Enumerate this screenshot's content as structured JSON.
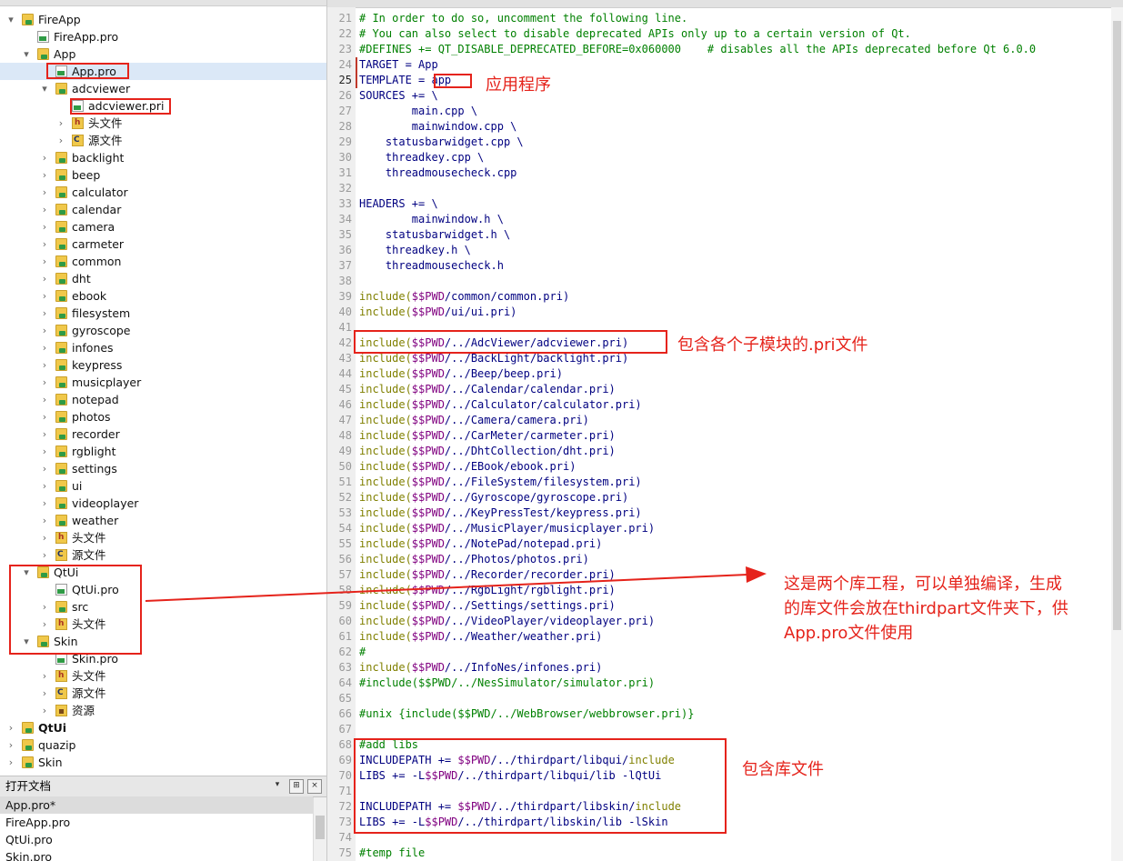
{
  "tree": [
    {
      "label": "FireApp",
      "icon": "folder",
      "arrow": "▾",
      "indent": 0
    },
    {
      "label": "FireApp.pro",
      "icon": "filepro",
      "arrow": "",
      "indent": 1
    },
    {
      "label": "App",
      "icon": "folder",
      "arrow": "▾",
      "indent": 1
    },
    {
      "label": "App.pro",
      "icon": "filepro",
      "arrow": "",
      "indent": 2,
      "selected": true
    },
    {
      "label": "adcviewer",
      "icon": "folder",
      "arrow": "▾",
      "indent": 2
    },
    {
      "label": "adcviewer.pri",
      "icon": "filepro",
      "arrow": "",
      "indent": 3
    },
    {
      "label": "头文件",
      "icon": "hdr",
      "arrow": "›",
      "indent": 3
    },
    {
      "label": "源文件",
      "icon": "src",
      "arrow": "›",
      "indent": 3
    },
    {
      "label": "backlight",
      "icon": "folder",
      "arrow": "›",
      "indent": 2
    },
    {
      "label": "beep",
      "icon": "folder",
      "arrow": "›",
      "indent": 2
    },
    {
      "label": "calculator",
      "icon": "folder",
      "arrow": "›",
      "indent": 2
    },
    {
      "label": "calendar",
      "icon": "folder",
      "arrow": "›",
      "indent": 2
    },
    {
      "label": "camera",
      "icon": "folder",
      "arrow": "›",
      "indent": 2
    },
    {
      "label": "carmeter",
      "icon": "folder",
      "arrow": "›",
      "indent": 2
    },
    {
      "label": "common",
      "icon": "folder",
      "arrow": "›",
      "indent": 2
    },
    {
      "label": "dht",
      "icon": "folder",
      "arrow": "›",
      "indent": 2
    },
    {
      "label": "ebook",
      "icon": "folder",
      "arrow": "›",
      "indent": 2
    },
    {
      "label": "filesystem",
      "icon": "folder",
      "arrow": "›",
      "indent": 2
    },
    {
      "label": "gyroscope",
      "icon": "folder",
      "arrow": "›",
      "indent": 2
    },
    {
      "label": "infones",
      "icon": "folder",
      "arrow": "›",
      "indent": 2
    },
    {
      "label": "keypress",
      "icon": "folder",
      "arrow": "›",
      "indent": 2
    },
    {
      "label": "musicplayer",
      "icon": "folder",
      "arrow": "›",
      "indent": 2
    },
    {
      "label": "notepad",
      "icon": "folder",
      "arrow": "›",
      "indent": 2
    },
    {
      "label": "photos",
      "icon": "folder",
      "arrow": "›",
      "indent": 2
    },
    {
      "label": "recorder",
      "icon": "folder",
      "arrow": "›",
      "indent": 2
    },
    {
      "label": "rgblight",
      "icon": "folder",
      "arrow": "›",
      "indent": 2
    },
    {
      "label": "settings",
      "icon": "folder",
      "arrow": "›",
      "indent": 2
    },
    {
      "label": "ui",
      "icon": "folder",
      "arrow": "›",
      "indent": 2
    },
    {
      "label": "videoplayer",
      "icon": "folder",
      "arrow": "›",
      "indent": 2
    },
    {
      "label": "weather",
      "icon": "folder",
      "arrow": "›",
      "indent": 2
    },
    {
      "label": "头文件",
      "icon": "hdr",
      "arrow": "›",
      "indent": 2
    },
    {
      "label": "源文件",
      "icon": "src",
      "arrow": "›",
      "indent": 2
    },
    {
      "label": "QtUi",
      "icon": "folder",
      "arrow": "▾",
      "indent": 1
    },
    {
      "label": "QtUi.pro",
      "icon": "filepro",
      "arrow": "",
      "indent": 2
    },
    {
      "label": "src",
      "icon": "folder",
      "arrow": "›",
      "indent": 2
    },
    {
      "label": "头文件",
      "icon": "hdr",
      "arrow": "›",
      "indent": 2
    },
    {
      "label": "Skin",
      "icon": "folder",
      "arrow": "▾",
      "indent": 1
    },
    {
      "label": "Skin.pro",
      "icon": "filepro",
      "arrow": "",
      "indent": 2
    },
    {
      "label": "头文件",
      "icon": "hdr",
      "arrow": "›",
      "indent": 2
    },
    {
      "label": "源文件",
      "icon": "src",
      "arrow": "›",
      "indent": 2
    },
    {
      "label": "资源",
      "icon": "res",
      "arrow": "›",
      "indent": 2
    },
    {
      "label": "QtUi",
      "icon": "folder",
      "arrow": "›",
      "indent": 0,
      "bold": true
    },
    {
      "label": "quazip",
      "icon": "folder",
      "arrow": "›",
      "indent": 0
    },
    {
      "label": "Skin",
      "icon": "folder",
      "arrow": "›",
      "indent": 0
    }
  ],
  "open_docs": {
    "title": "打开文档",
    "items": [
      "App.pro*",
      "FireApp.pro",
      "QtUi.pro",
      "Skin.pro"
    ]
  },
  "editor": {
    "current_line": 25,
    "lines": [
      {
        "n": 21,
        "p": [
          [
            "# In order to do so, uncomment the following line.",
            "c"
          ]
        ]
      },
      {
        "n": 22,
        "p": [
          [
            "# You can also select to disable deprecated APIs only up to a certain version of Qt.",
            "c"
          ]
        ]
      },
      {
        "n": 23,
        "p": [
          [
            "#DEFINES += QT_DISABLE_DEPRECATED_BEFORE=0x060000    # disables all the APIs deprecated before Qt 6.0.0",
            "c"
          ]
        ]
      },
      {
        "n": 24,
        "p": [
          [
            "TARGET = App",
            "p"
          ]
        ]
      },
      {
        "n": 25,
        "p": [
          [
            "TEMPLATE = app",
            "p"
          ]
        ]
      },
      {
        "n": 26,
        "p": [
          [
            "SOURCES += \\",
            "p"
          ]
        ]
      },
      {
        "n": 27,
        "p": [
          [
            "        main.cpp \\",
            "p"
          ]
        ]
      },
      {
        "n": 28,
        "p": [
          [
            "        mainwindow.cpp \\",
            "p"
          ]
        ]
      },
      {
        "n": 29,
        "p": [
          [
            "    statusbarwidget.cpp \\",
            "p"
          ]
        ]
      },
      {
        "n": 30,
        "p": [
          [
            "    threadkey.cpp \\",
            "p"
          ]
        ]
      },
      {
        "n": 31,
        "p": [
          [
            "    threadmousecheck.cpp",
            "p"
          ]
        ]
      },
      {
        "n": 32,
        "p": []
      },
      {
        "n": 33,
        "p": [
          [
            "HEADERS += \\",
            "p"
          ]
        ]
      },
      {
        "n": 34,
        "p": [
          [
            "        mainwindow.h \\",
            "p"
          ]
        ]
      },
      {
        "n": 35,
        "p": [
          [
            "    statusbarwidget.h \\",
            "p"
          ]
        ]
      },
      {
        "n": 36,
        "p": [
          [
            "    threadkey.h \\",
            "p"
          ]
        ]
      },
      {
        "n": 37,
        "p": [
          [
            "    threadmousecheck.h",
            "p"
          ]
        ]
      },
      {
        "n": 38,
        "p": []
      },
      {
        "n": 39,
        "p": [
          [
            "include(",
            "k"
          ],
          [
            "$$PWD",
            "v"
          ],
          [
            "/common/common.pri)",
            "p"
          ]
        ]
      },
      {
        "n": 40,
        "p": [
          [
            "include(",
            "k"
          ],
          [
            "$$PWD",
            "v"
          ],
          [
            "/ui/ui.pri)",
            "p"
          ]
        ]
      },
      {
        "n": 41,
        "p": []
      },
      {
        "n": 42,
        "p": [
          [
            "include(",
            "k"
          ],
          [
            "$$PWD",
            "v"
          ],
          [
            "/../AdcViewer/adcviewer.pri)",
            "p"
          ]
        ]
      },
      {
        "n": 43,
        "p": [
          [
            "include(",
            "k"
          ],
          [
            "$$PWD",
            "v"
          ],
          [
            "/../BackLight/backlight.pri)",
            "p"
          ]
        ]
      },
      {
        "n": 44,
        "p": [
          [
            "include(",
            "k"
          ],
          [
            "$$PWD",
            "v"
          ],
          [
            "/../Beep/beep.pri)",
            "p"
          ]
        ]
      },
      {
        "n": 45,
        "p": [
          [
            "include(",
            "k"
          ],
          [
            "$$PWD",
            "v"
          ],
          [
            "/../Calendar/calendar.pri)",
            "p"
          ]
        ]
      },
      {
        "n": 46,
        "p": [
          [
            "include(",
            "k"
          ],
          [
            "$$PWD",
            "v"
          ],
          [
            "/../Calculator/calculator.pri)",
            "p"
          ]
        ]
      },
      {
        "n": 47,
        "p": [
          [
            "include(",
            "k"
          ],
          [
            "$$PWD",
            "v"
          ],
          [
            "/../Camera/camera.pri)",
            "p"
          ]
        ]
      },
      {
        "n": 48,
        "p": [
          [
            "include(",
            "k"
          ],
          [
            "$$PWD",
            "v"
          ],
          [
            "/../CarMeter/carmeter.pri)",
            "p"
          ]
        ]
      },
      {
        "n": 49,
        "p": [
          [
            "include(",
            "k"
          ],
          [
            "$$PWD",
            "v"
          ],
          [
            "/../DhtCollection/dht.pri)",
            "p"
          ]
        ]
      },
      {
        "n": 50,
        "p": [
          [
            "include(",
            "k"
          ],
          [
            "$$PWD",
            "v"
          ],
          [
            "/../EBook/ebook.pri)",
            "p"
          ]
        ]
      },
      {
        "n": 51,
        "p": [
          [
            "include(",
            "k"
          ],
          [
            "$$PWD",
            "v"
          ],
          [
            "/../FileSystem/filesystem.pri)",
            "p"
          ]
        ]
      },
      {
        "n": 52,
        "p": [
          [
            "include(",
            "k"
          ],
          [
            "$$PWD",
            "v"
          ],
          [
            "/../Gyroscope/gyroscope.pri)",
            "p"
          ]
        ]
      },
      {
        "n": 53,
        "p": [
          [
            "include(",
            "k"
          ],
          [
            "$$PWD",
            "v"
          ],
          [
            "/../KeyPressTest/keypress.pri)",
            "p"
          ]
        ]
      },
      {
        "n": 54,
        "p": [
          [
            "include(",
            "k"
          ],
          [
            "$$PWD",
            "v"
          ],
          [
            "/../MusicPlayer/musicplayer.pri)",
            "p"
          ]
        ]
      },
      {
        "n": 55,
        "p": [
          [
            "include(",
            "k"
          ],
          [
            "$$PWD",
            "v"
          ],
          [
            "/../NotePad/notepad.pri)",
            "p"
          ]
        ]
      },
      {
        "n": 56,
        "p": [
          [
            "include(",
            "k"
          ],
          [
            "$$PWD",
            "v"
          ],
          [
            "/../Photos/photos.pri)",
            "p"
          ]
        ]
      },
      {
        "n": 57,
        "p": [
          [
            "include(",
            "k"
          ],
          [
            "$$PWD",
            "v"
          ],
          [
            "/../Recorder/recorder.pri)",
            "p"
          ]
        ]
      },
      {
        "n": 58,
        "p": [
          [
            "include(",
            "k"
          ],
          [
            "$$PWD",
            "v"
          ],
          [
            "/../RgbLight/rgblight.pri)",
            "p"
          ]
        ]
      },
      {
        "n": 59,
        "p": [
          [
            "include(",
            "k"
          ],
          [
            "$$PWD",
            "v"
          ],
          [
            "/../Settings/settings.pri)",
            "p"
          ]
        ]
      },
      {
        "n": 60,
        "p": [
          [
            "include(",
            "k"
          ],
          [
            "$$PWD",
            "v"
          ],
          [
            "/../VideoPlayer/videoplayer.pri)",
            "p"
          ]
        ]
      },
      {
        "n": 61,
        "p": [
          [
            "include(",
            "k"
          ],
          [
            "$$PWD",
            "v"
          ],
          [
            "/../Weather/weather.pri)",
            "p"
          ]
        ]
      },
      {
        "n": 62,
        "p": [
          [
            "#",
            "c"
          ]
        ]
      },
      {
        "n": 63,
        "p": [
          [
            "include(",
            "k"
          ],
          [
            "$$PWD",
            "v"
          ],
          [
            "/../InfoNes/infones.pri)",
            "p"
          ]
        ]
      },
      {
        "n": 64,
        "p": [
          [
            "#include($$PWD/../NesSimulator/simulator.pri)",
            "c"
          ]
        ]
      },
      {
        "n": 65,
        "p": []
      },
      {
        "n": 66,
        "p": [
          [
            "#unix {include($$PWD/../WebBrowser/webbrowser.pri)}",
            "c"
          ]
        ]
      },
      {
        "n": 67,
        "p": []
      },
      {
        "n": 68,
        "p": [
          [
            "#add libs",
            "c"
          ]
        ]
      },
      {
        "n": 69,
        "p": [
          [
            "INCLUDEPATH += ",
            "p"
          ],
          [
            "$$PWD",
            "v"
          ],
          [
            "/../thirdpart/libqui/",
            "p"
          ],
          [
            "include",
            "k"
          ]
        ]
      },
      {
        "n": 70,
        "p": [
          [
            "LIBS += -L",
            "p"
          ],
          [
            "$$PWD",
            "v"
          ],
          [
            "/../thirdpart/libqui/lib -lQtUi",
            "p"
          ]
        ]
      },
      {
        "n": 71,
        "p": []
      },
      {
        "n": 72,
        "p": [
          [
            "INCLUDEPATH += ",
            "p"
          ],
          [
            "$$PWD",
            "v"
          ],
          [
            "/../thirdpart/libskin/",
            "p"
          ],
          [
            "include",
            "k"
          ]
        ]
      },
      {
        "n": 73,
        "p": [
          [
            "LIBS += -L",
            "p"
          ],
          [
            "$$PWD",
            "v"
          ],
          [
            "/../thirdpart/libskin/lib -lSkin",
            "p"
          ]
        ]
      },
      {
        "n": 74,
        "p": []
      },
      {
        "n": 75,
        "p": [
          [
            "#temp file",
            "c"
          ]
        ]
      }
    ]
  },
  "annotations": {
    "app_label": "应用程序",
    "pri_label": "包含各个子模块的.pri文件",
    "lib_project_note_l1": "这是两个库工程，可以单独编译，生成",
    "lib_project_note_l2": "的库文件会放在thirdpart文件夹下，供",
    "lib_project_note_l3": "App.pro文件使用",
    "libs_label": "包含库文件"
  },
  "colors": {
    "accent_red": "#e5231b",
    "comment": "#008000",
    "keyword": "#808000",
    "variable": "#800080",
    "code": "#000080"
  }
}
